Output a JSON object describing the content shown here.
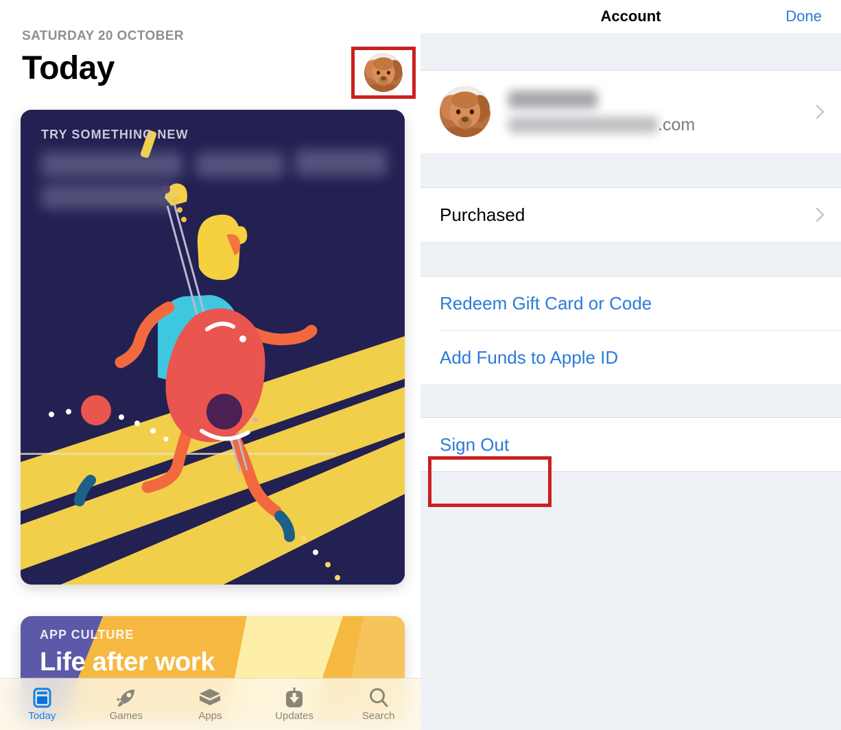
{
  "left": {
    "date": "SATURDAY 20 OCTOBER",
    "title": "Today",
    "avatar_icon": "dog-avatar-image",
    "cards": [
      {
        "eyebrow": "TRY SOMETHING NEW",
        "title_redacted": true,
        "illustration": "running-guitarist-illustration"
      },
      {
        "eyebrow": "APP CULTURE",
        "title": "Life after work"
      }
    ],
    "tabs": [
      {
        "label": "Today",
        "icon": "today-card-icon",
        "active": true
      },
      {
        "label": "Games",
        "icon": "rocket-icon",
        "active": false
      },
      {
        "label": "Apps",
        "icon": "layers-icon",
        "active": false
      },
      {
        "label": "Updates",
        "icon": "download-arrow-icon",
        "active": false
      },
      {
        "label": "Search",
        "icon": "search-icon",
        "active": false
      }
    ]
  },
  "right": {
    "nav": {
      "title": "Account",
      "done_label": "Done"
    },
    "account_row": {
      "avatar_icon": "dog-avatar-image",
      "name_redacted": true,
      "email_visible_suffix": ".com",
      "chevron_icon": "chevron-right-icon"
    },
    "rows": [
      {
        "label": "Purchased",
        "style": "dark",
        "chevron": true
      },
      {
        "label": "Redeem Gift Card or Code",
        "style": "link",
        "chevron": false
      },
      {
        "label": "Add Funds to Apple ID",
        "style": "link",
        "chevron": false
      },
      {
        "label": "Sign Out",
        "style": "link",
        "chevron": false,
        "highlighted": true
      }
    ]
  },
  "colors": {
    "accent_blue": "#2b7bd6",
    "annotation_red": "#cc1f1f",
    "sheet_background": "#eef1f5",
    "card_navy": "#232152",
    "card_yellow": "#f5b942",
    "illustration_red": "#e8564e",
    "illustration_cyan": "#3ec8e0",
    "illustration_orange": "#f2693f"
  }
}
